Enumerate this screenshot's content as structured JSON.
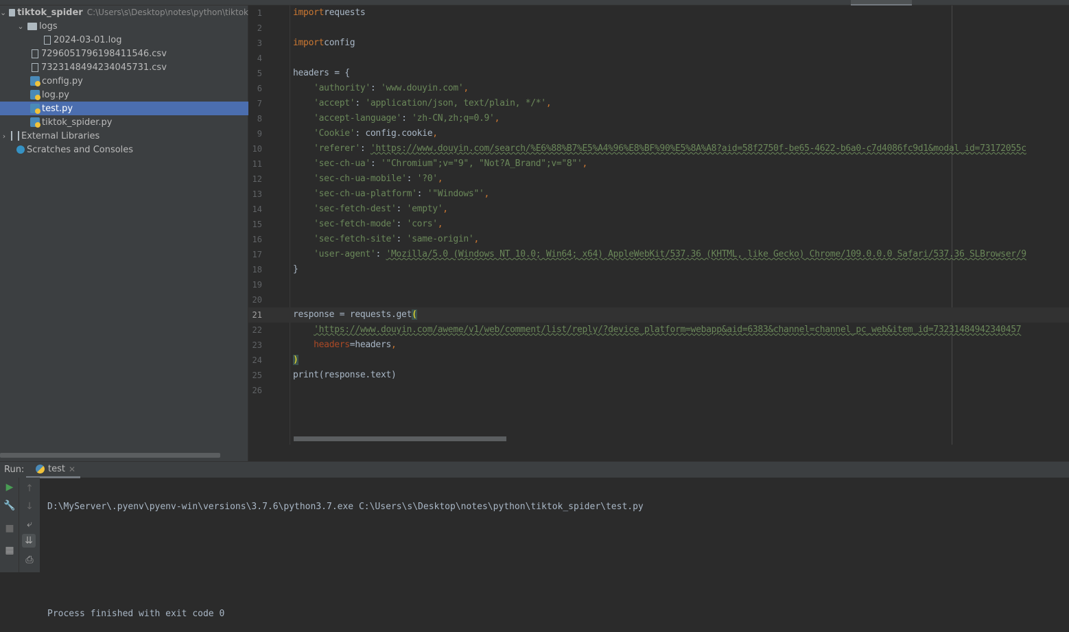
{
  "project_tree": {
    "root": {
      "name": "tiktok_spider",
      "path": "C:\\Users\\s\\Desktop\\notes\\python\\tiktok"
    },
    "items": [
      {
        "label": "logs",
        "type": "folder",
        "depth": 1,
        "expanded": true
      },
      {
        "label": "2024-03-01.log",
        "type": "file",
        "depth": 2
      },
      {
        "label": "7296051796198411546.csv",
        "type": "file",
        "depth": 1
      },
      {
        "label": "7323148494234045731.csv",
        "type": "file",
        "depth": 1
      },
      {
        "label": "config.py",
        "type": "python",
        "depth": 1
      },
      {
        "label": "log.py",
        "type": "python",
        "depth": 1
      },
      {
        "label": "test.py",
        "type": "python",
        "depth": 1,
        "selected": true
      },
      {
        "label": "tiktok_spider.py",
        "type": "python",
        "depth": 1
      }
    ],
    "external_libraries": "External Libraries",
    "scratches": "Scratches and Consoles"
  },
  "editor": {
    "current_line": 21,
    "lines": [
      [
        [
          "kw",
          "import"
        ],
        [
          "",
          "requests"
        ]
      ],
      [],
      [
        [
          "kw",
          "import"
        ],
        [
          "",
          "config"
        ]
      ],
      [],
      [
        [
          "",
          "headers = {"
        ]
      ],
      [
        [
          "",
          "    "
        ],
        [
          "str",
          "'authority'"
        ],
        [
          "",
          ": "
        ],
        [
          "str",
          "'www.douyin.com'"
        ],
        [
          "punc",
          ","
        ]
      ],
      [
        [
          "",
          "    "
        ],
        [
          "str",
          "'accept'"
        ],
        [
          "",
          ": "
        ],
        [
          "str",
          "'application/json, text/plain, */*'"
        ],
        [
          "punc",
          ","
        ]
      ],
      [
        [
          "",
          "    "
        ],
        [
          "str",
          "'accept-language'"
        ],
        [
          "",
          ": "
        ],
        [
          "str",
          "'zh-CN,zh;q=0.9'"
        ],
        [
          "punc",
          ","
        ]
      ],
      [
        [
          "",
          "    "
        ],
        [
          "str",
          "'Cookie'"
        ],
        [
          "",
          ": config.cookie"
        ],
        [
          "punc",
          ","
        ]
      ],
      [
        [
          "",
          "    "
        ],
        [
          "str",
          "'referer'"
        ],
        [
          "",
          ": "
        ],
        [
          "url",
          "'https://www.douyin.com/search/%E6%88%B7%E5%A4%96%E8%BF%90%E5%8A%A8?aid=58f2750f-be65-4622-b6a0-c7d4086fc9d1&modal_id=73172055c"
        ]
      ],
      [
        [
          "",
          "    "
        ],
        [
          "str",
          "'sec-ch-ua'"
        ],
        [
          "",
          ": "
        ],
        [
          "str",
          "'\"Chromium\";v=\"9\", \"Not?A_Brand\";v=\"8\"'"
        ],
        [
          "punc",
          ","
        ]
      ],
      [
        [
          "",
          "    "
        ],
        [
          "str",
          "'sec-ch-ua-mobile'"
        ],
        [
          "",
          ": "
        ],
        [
          "str",
          "'?0'"
        ],
        [
          "punc",
          ","
        ]
      ],
      [
        [
          "",
          "    "
        ],
        [
          "str",
          "'sec-ch-ua-platform'"
        ],
        [
          "",
          ": "
        ],
        [
          "str",
          "'\"Windows\"'"
        ],
        [
          "punc",
          ","
        ]
      ],
      [
        [
          "",
          "    "
        ],
        [
          "str",
          "'sec-fetch-dest'"
        ],
        [
          "",
          ": "
        ],
        [
          "str",
          "'empty'"
        ],
        [
          "punc",
          ","
        ]
      ],
      [
        [
          "",
          "    "
        ],
        [
          "str",
          "'sec-fetch-mode'"
        ],
        [
          "",
          ": "
        ],
        [
          "str",
          "'cors'"
        ],
        [
          "punc",
          ","
        ]
      ],
      [
        [
          "",
          "    "
        ],
        [
          "str",
          "'sec-fetch-site'"
        ],
        [
          "",
          ": "
        ],
        [
          "str",
          "'same-origin'"
        ],
        [
          "punc",
          ","
        ]
      ],
      [
        [
          "",
          "    "
        ],
        [
          "str",
          "'user-agent'"
        ],
        [
          "",
          ": "
        ],
        [
          "url",
          "'Mozilla/5.0 (Windows NT 10.0; Win64; x64) AppleWebKit/537.36 (KHTML, like Gecko) Chrome/109.0.0.0 Safari/537.36 SLBrowser/9"
        ]
      ],
      [
        [
          "",
          "}"
        ]
      ],
      [],
      [],
      [
        [
          "",
          "response = requests.get"
        ],
        [
          "match",
          "("
        ]
      ],
      [
        [
          "",
          "    "
        ],
        [
          "url",
          "'https://www.douyin.com/aweme/v1/web/comment/list/reply/?device_platform=webapp&aid=6383&channel=channel_pc_web&item_id=73231484942340457"
        ]
      ],
      [
        [
          "",
          "    "
        ],
        [
          "param",
          "headers"
        ],
        [
          "",
          "=headers"
        ],
        [
          "punc",
          ","
        ]
      ],
      [
        [
          "match",
          ")"
        ]
      ],
      [
        [
          "",
          "print(response.text)"
        ]
      ],
      []
    ]
  },
  "run_panel": {
    "label": "Run:",
    "tab": "test",
    "output": [
      "D:\\MyServer\\.pyenv\\pyenv-win\\versions\\3.7.6\\python3.7.exe C:\\Users\\s\\Desktop\\notes\\python\\tiktok_spider\\test.py",
      "",
      "",
      "Process finished with exit code 0"
    ]
  }
}
